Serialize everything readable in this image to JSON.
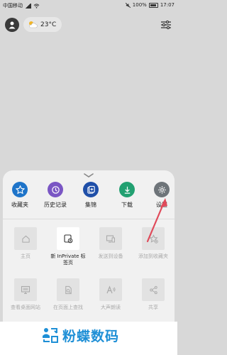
{
  "status": {
    "carrier": "中国移动",
    "battery": "100%",
    "time": "17:07"
  },
  "topbar": {
    "temperature": "23°C"
  },
  "quick_actions": [
    {
      "label": "收藏夹",
      "icon": "star-icon",
      "color": "#1e74c9"
    },
    {
      "label": "历史记录",
      "icon": "history-icon",
      "color": "#7a56c4"
    },
    {
      "label": "集锦",
      "icon": "collections-icon",
      "color": "#1f4fa8"
    },
    {
      "label": "下载",
      "icon": "download-icon",
      "color": "#22a071"
    },
    {
      "label": "设置",
      "icon": "gear-icon",
      "color": "#6e7479"
    }
  ],
  "tiles": [
    {
      "label": "主页",
      "icon": "home-icon",
      "active": false
    },
    {
      "label": "新 InPrivate 标签页",
      "icon": "inprivate-tab-icon",
      "active": true
    },
    {
      "label": "发送到设备",
      "icon": "send-to-device-icon",
      "active": false
    },
    {
      "label": "添加到收藏夹",
      "icon": "add-favorite-icon",
      "active": false
    },
    {
      "label": "查看桌面网站",
      "icon": "desktop-site-icon",
      "active": false
    },
    {
      "label": "在页面上查找",
      "icon": "find-on-page-icon",
      "active": false
    },
    {
      "label": "大声朗读",
      "icon": "read-aloud-icon",
      "active": false
    },
    {
      "label": "共享",
      "icon": "share-icon",
      "active": false
    }
  ],
  "watermark": {
    "text": "粉蝶数码"
  },
  "accent_arrow_color": "#e04a5a"
}
